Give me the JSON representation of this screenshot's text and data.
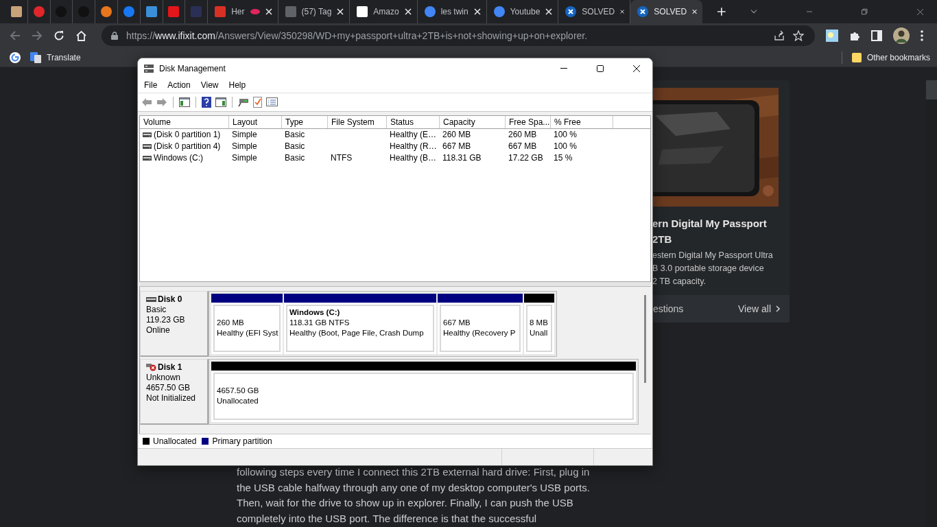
{
  "browser": {
    "tabs": [
      {
        "selected": false
      },
      {
        "selected": false
      },
      {
        "selected": false
      },
      {
        "selected": false
      },
      {
        "selected": false
      },
      {
        "selected": false
      },
      {
        "selected": false
      },
      {
        "selected": false
      },
      {
        "selected": false
      },
      {
        "title": "Her",
        "selected": false
      },
      {
        "title": "(57) Tag",
        "selected": false
      },
      {
        "title": "Amazo",
        "selected": false
      },
      {
        "title": "les twin",
        "selected": false
      },
      {
        "title": "Youtube",
        "selected": false
      },
      {
        "title": "SOLVED",
        "selected": false
      },
      {
        "title": "SOLVED",
        "selected": true
      }
    ],
    "address": {
      "scheme": "https://",
      "host": "www.ifixit.com",
      "path": "/Answers/View/350298/WD+my+passport+ultra+2TB+is+not+showing+up+on+explorer."
    },
    "bookmarks": [
      {
        "label": "Translate"
      }
    ],
    "other_bookmarks": "Other bookmarks"
  },
  "page": {
    "paragraph": "following steps every time I connect this 2TB external hard drive: First, plug in the USB cable halfway through any one of my desktop computer's USB ports. Then, wait for the drive to show up in explorer. Finally, I can push the USB completely into the USB port. The difference is that the successful",
    "card": {
      "title_lines": [
        "ern Digital My Passport",
        "2TB"
      ],
      "description_lines": [
        "estern Digital My Passport Ultra",
        "B 3.0 portable storage device",
        "2 TB capacity."
      ],
      "footer_text": "estions",
      "footer_link": "View all"
    }
  },
  "window": {
    "title": "Disk Management",
    "menu": [
      "File",
      "Action",
      "View",
      "Help"
    ],
    "table": {
      "columns": [
        "Volume",
        "Layout",
        "Type",
        "File System",
        "Status",
        "Capacity",
        "Free Spa...",
        "% Free"
      ],
      "rows": [
        {
          "cells": [
            "(Disk 0 partition 1)",
            "Simple",
            "Basic",
            "",
            "Healthy (E…",
            "260 MB",
            "260 MB",
            "100 %"
          ]
        },
        {
          "cells": [
            "(Disk 0 partition 4)",
            "Simple",
            "Basic",
            "",
            "Healthy (R…",
            "667 MB",
            "667 MB",
            "100 %"
          ]
        },
        {
          "cells": [
            "Windows (C:)",
            "Simple",
            "Basic",
            "NTFS",
            "Healthy (B…",
            "118.31 GB",
            "17.22 GB",
            "15 %"
          ]
        }
      ]
    },
    "disks": [
      {
        "kind": "basic",
        "name": "Disk 0",
        "lines": [
          "Basic",
          "119.23 GB",
          "Online"
        ],
        "partitions": [
          {
            "kind": "primary",
            "size": "260 MB",
            "status": "Healthy (EFI Syst"
          },
          {
            "kind": "primary",
            "name": "Windows  (C:)",
            "size": "118.31 GB NTFS",
            "status": "Healthy (Boot, Page File, Crash Dump"
          },
          {
            "kind": "primary",
            "size": "667 MB",
            "status": "Healthy (Recovery P"
          },
          {
            "kind": "unallocated",
            "size": "8 MB",
            "status": "Unall"
          }
        ]
      },
      {
        "kind": "error",
        "name": "Disk 1",
        "lines": [
          "Unknown",
          "4657.50 GB",
          "Not Initialized"
        ],
        "partitions": [
          {
            "kind": "unallocated",
            "size": "4657.50 GB",
            "status": "Unallocated"
          }
        ]
      }
    ],
    "legend": [
      {
        "label": "Unallocated",
        "color": "#000000"
      },
      {
        "label": "Primary partition",
        "color": "#000080"
      }
    ]
  }
}
